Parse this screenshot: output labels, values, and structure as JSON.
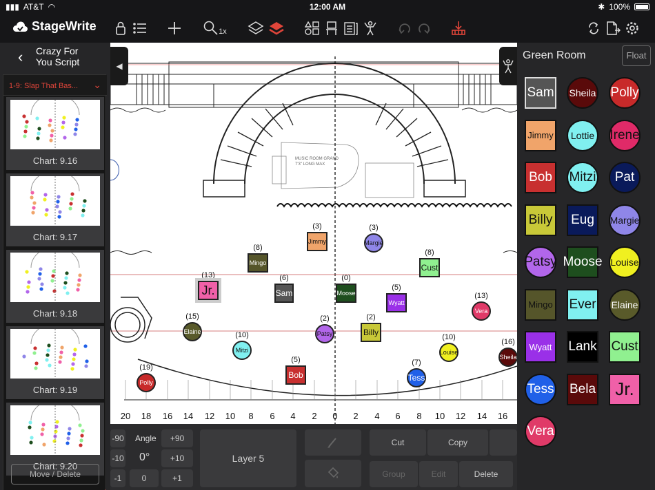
{
  "status": {
    "carrier": "AT&T",
    "time": "12:00 AM",
    "battery": "100%"
  },
  "app": {
    "name": "StageWrite",
    "zoom": "1x"
  },
  "script": {
    "title_line1": "Crazy For",
    "title_line2": "You Script",
    "scene": "1-9: Slap That Bas..."
  },
  "charts": [
    "Chart: 9.16",
    "Chart: 9.17",
    "Chart: 9.18",
    "Chart: 9.19",
    "Chart: 9.20"
  ],
  "move_delete": "Move / Delete",
  "set": {
    "piano_label1": "MUSIC ROOM GRAND",
    "piano_label2": "7'3\" LONG MAX"
  },
  "axis": [
    "20",
    "18",
    "16",
    "14",
    "12",
    "10",
    "8",
    "6",
    "4",
    "2",
    "0",
    "2",
    "4",
    "6",
    "8",
    "10",
    "12",
    "14",
    "16"
  ],
  "stage_actors": [
    {
      "name": "Jimmy",
      "num": "(3)",
      "color": "#f0a46a",
      "shape": "sq"
    },
    {
      "name": "Margie",
      "num": "(3)",
      "color": "#8f86e8",
      "shape": "circ"
    },
    {
      "name": "Mingo",
      "num": "(8)",
      "color": "#55552a",
      "shape": "sq"
    },
    {
      "name": "Cust",
      "num": "(8)",
      "color": "#90f090",
      "shape": "sq"
    },
    {
      "name": "Jr.",
      "num": "(13)",
      "color": "#f060a8",
      "shape": "sq"
    },
    {
      "name": "Sam",
      "num": "(6)",
      "color": "#555555",
      "shape": "sq"
    },
    {
      "name": "Moose",
      "num": "(0)",
      "color": "#1e4e1e",
      "shape": "sq"
    },
    {
      "name": "Wyatt",
      "num": "(5)",
      "color": "#9a30e8",
      "shape": "sq"
    },
    {
      "name": "Vera",
      "num": "(13)",
      "color": "#e03a68",
      "shape": "circ"
    },
    {
      "name": "Elaine",
      "num": "(15)",
      "color": "#595a2a",
      "shape": "circ"
    },
    {
      "name": "Patsy",
      "num": "(2)",
      "color": "#b266ea",
      "shape": "circ"
    },
    {
      "name": "Billy",
      "num": "(2)",
      "color": "#c8c838",
      "shape": "sq"
    },
    {
      "name": "Mitzi",
      "num": "(10)",
      "color": "#80f0f0",
      "shape": "circ"
    },
    {
      "name": "Louise",
      "num": "(10)",
      "color": "#f0f020",
      "shape": "circ"
    },
    {
      "name": "Sheila",
      "num": "(16)",
      "color": "#5a0a0a",
      "shape": "circ"
    },
    {
      "name": "Bob",
      "num": "(5)",
      "color": "#c83030",
      "shape": "sq"
    },
    {
      "name": "Tess",
      "num": "(7)",
      "color": "#2060e8",
      "shape": "circ"
    },
    {
      "name": "Polly",
      "num": "(19)",
      "color": "#c82a2a",
      "shape": "circ"
    }
  ],
  "controls": {
    "angle_label": "Angle",
    "angle_value": "0°",
    "plus90": "+90",
    "minus90": "-90",
    "plus10": "+10",
    "minus10": "-10",
    "plus1": "+1",
    "minus1": "-1",
    "zero": "0",
    "layer": "Layer 5",
    "cut": "Cut",
    "copy": "Copy",
    "group": "Group",
    "edit": "Edit",
    "delete": "Delete"
  },
  "green_room": {
    "title": "Green Room",
    "float": "Float",
    "actors": [
      {
        "name": "Sam",
        "color": "#555555",
        "shape": "sq",
        "text": "light"
      },
      {
        "name": "Sheila",
        "color": "#5a0a0a",
        "shape": "circ",
        "text": "light"
      },
      {
        "name": "Polly",
        "color": "#c82a2a",
        "shape": "circ",
        "text": "light"
      },
      {
        "name": "Jimmy",
        "color": "#f0a46a",
        "shape": "sq",
        "text": "dark"
      },
      {
        "name": "Lottie",
        "color": "#80f0f0",
        "shape": "circ",
        "text": "dark"
      },
      {
        "name": "Irene",
        "color": "#e02a68",
        "shape": "circ",
        "text": "dark"
      },
      {
        "name": "Bob",
        "color": "#c83030",
        "shape": "sq",
        "text": "light"
      },
      {
        "name": "Mitzi",
        "color": "#80f0f0",
        "shape": "circ",
        "text": "dark"
      },
      {
        "name": "Pat",
        "color": "#0a1a5a",
        "shape": "circ",
        "text": "light"
      },
      {
        "name": "Billy",
        "color": "#c8c838",
        "shape": "sq",
        "text": "dark"
      },
      {
        "name": "Eug",
        "color": "#0a1a5a",
        "shape": "sq",
        "text": "light"
      },
      {
        "name": "Margie",
        "color": "#8f86e8",
        "shape": "circ",
        "text": "dark"
      },
      {
        "name": "Patsy",
        "color": "#b266ea",
        "shape": "circ",
        "text": "dark"
      },
      {
        "name": "Moose",
        "color": "#1e4e1e",
        "shape": "sq",
        "text": "light"
      },
      {
        "name": "Louise",
        "color": "#f0f020",
        "shape": "circ",
        "text": "dark"
      },
      {
        "name": "Mingo",
        "color": "#55552a",
        "shape": "sq",
        "text": "dark"
      },
      {
        "name": "Ever",
        "color": "#80f0f0",
        "shape": "sq",
        "text": "dark"
      },
      {
        "name": "Elaine",
        "color": "#595a2a",
        "shape": "circ",
        "text": "light"
      },
      {
        "name": "Wyatt",
        "color": "#9a30e8",
        "shape": "sq",
        "text": "light"
      },
      {
        "name": "Lank",
        "color": "#000000",
        "shape": "sq",
        "text": "light"
      },
      {
        "name": "Cust",
        "color": "#90f090",
        "shape": "sq",
        "text": "dark"
      },
      {
        "name": "Tess",
        "color": "#2060e8",
        "shape": "circ",
        "text": "light"
      },
      {
        "name": "Bela",
        "color": "#5a0a0a",
        "shape": "sq",
        "text": "light"
      },
      {
        "name": "Jr.",
        "color": "#f060a8",
        "shape": "sq",
        "text": "dark"
      },
      {
        "name": "Vera",
        "color": "#e03a68",
        "shape": "circ",
        "text": "light"
      }
    ]
  }
}
